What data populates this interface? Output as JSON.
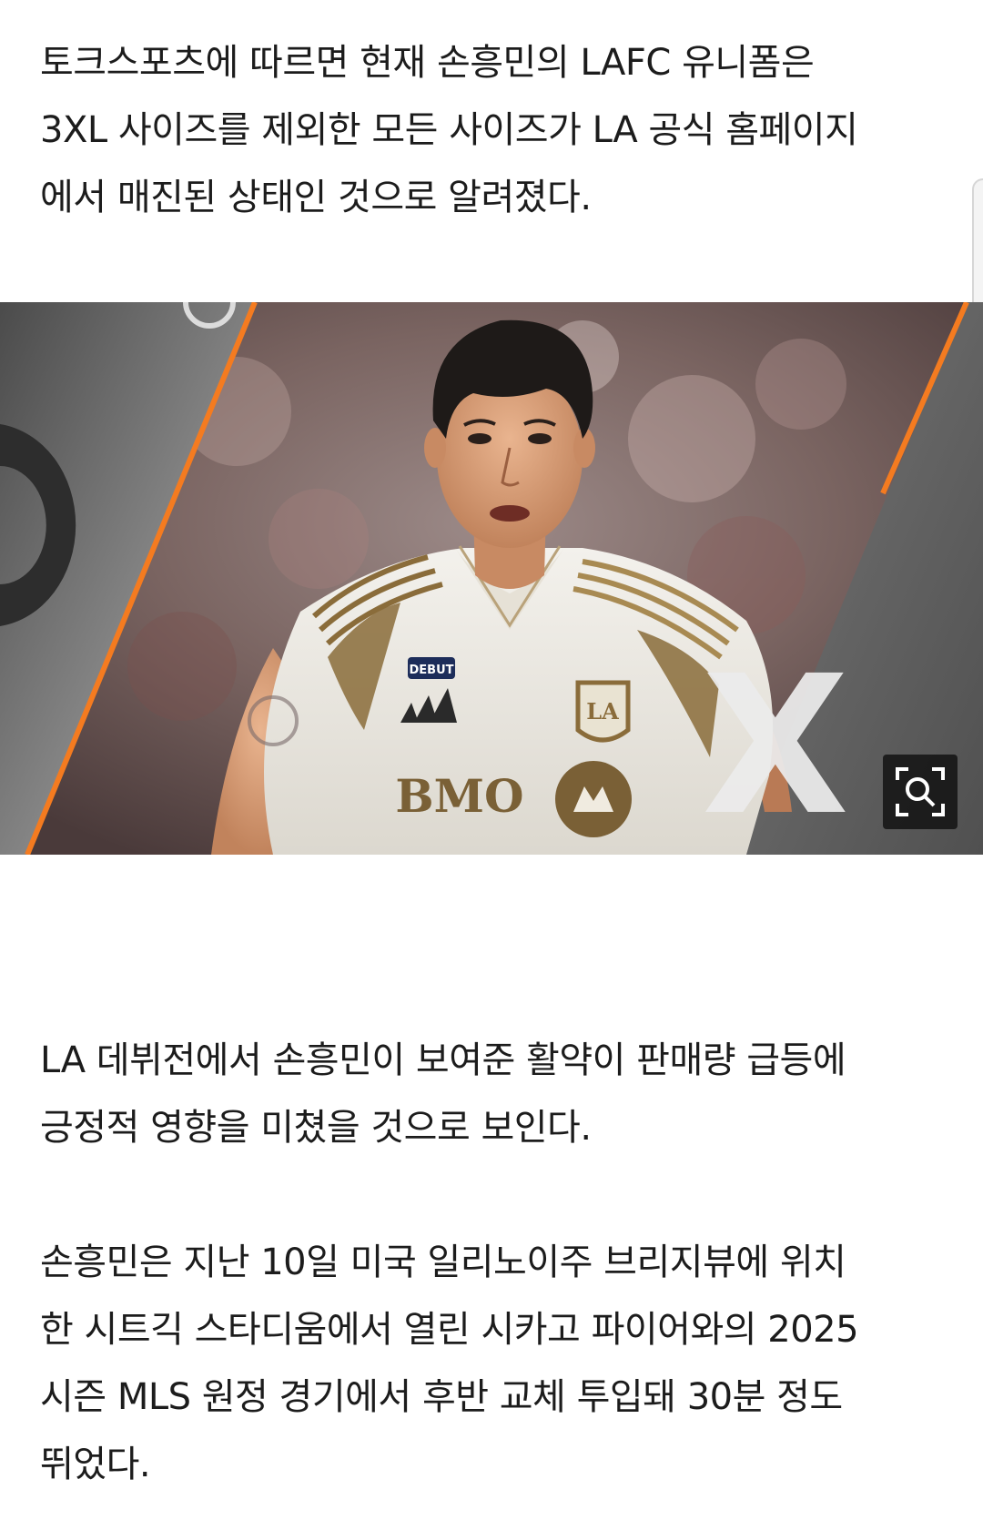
{
  "article": {
    "paragraph1": [
      "토크스포츠에 따르면 현재 손흥민의 LAFC 유니폼은",
      "3XL 사이즈를 제외한 모든 사이즈가 LA 공식 홈페이지",
      "에서 매진된 상태인 것으로 알려졌다."
    ],
    "paragraph2": [
      "LA 데뷔전에서 손흥민이 보여준 활약이 판매량 급등에",
      "긍정적 영향을 미쳤을 것으로 보인다."
    ],
    "paragraph3": [
      "손흥민은 지난 10일 미국 일리노이주 브리지뷰에 위치",
      "한 시트긱 스타디움에서 열린 시카고 파이어와의 2025",
      "시즌 MLS 원정 경기에서 후반 교체 투입돼 30분 정도",
      "뛰었다."
    ]
  },
  "photo": {
    "jersey_sponsor": "BMO",
    "jersey_patch": "DEBUT",
    "crest_text": "LA",
    "overlay_letter": "X",
    "accent_color": "#f47b20"
  },
  "icons": {
    "zoom": "zoom-search-icon"
  }
}
